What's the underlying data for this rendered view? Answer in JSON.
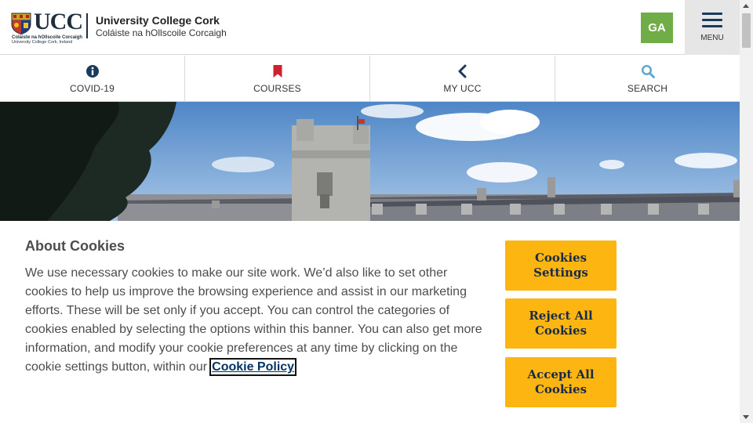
{
  "header": {
    "logo_text": "UCC",
    "logo_sub_irish": "Coláiste na hOllscoile Corcaigh",
    "logo_sub_english": "University College Cork, Ireland",
    "college_name": "University College Cork",
    "college_name_irish": "Coláiste na hOllscoile Corcaigh",
    "language_button": "GA",
    "menu_label": "MENU"
  },
  "nav": {
    "items": [
      {
        "label": "COVID-19",
        "icon": "info-circle-icon"
      },
      {
        "label": "COURSES",
        "icon": "bookmark-icon"
      },
      {
        "label": "MY UCC",
        "icon": "chevron-left-icon"
      },
      {
        "label": "SEARCH",
        "icon": "search-icon"
      }
    ]
  },
  "cookie_banner": {
    "title": "About Cookies",
    "text": "We use necessary cookies to make our site work. We’d also like to set other cookies to help us improve the browsing experience and assist in our marketing efforts. These will be set only if you accept. You can control the categories of cookies enabled by selecting the options within this banner. You can also get more information, and modify your cookie preferences at any time by clicking on the cookie settings button, within our",
    "link_label": "Cookie Policy",
    "buttons": {
      "settings": "Cookies Settings",
      "reject": "Reject All Cookies",
      "accept": "Accept All Cookies"
    }
  },
  "colors": {
    "button_yellow": "#fcb511",
    "ga_green": "#70ad47",
    "navy": "#1a3a5c",
    "courses_red": "#d0202e",
    "search_blue": "#5ba4d6"
  }
}
